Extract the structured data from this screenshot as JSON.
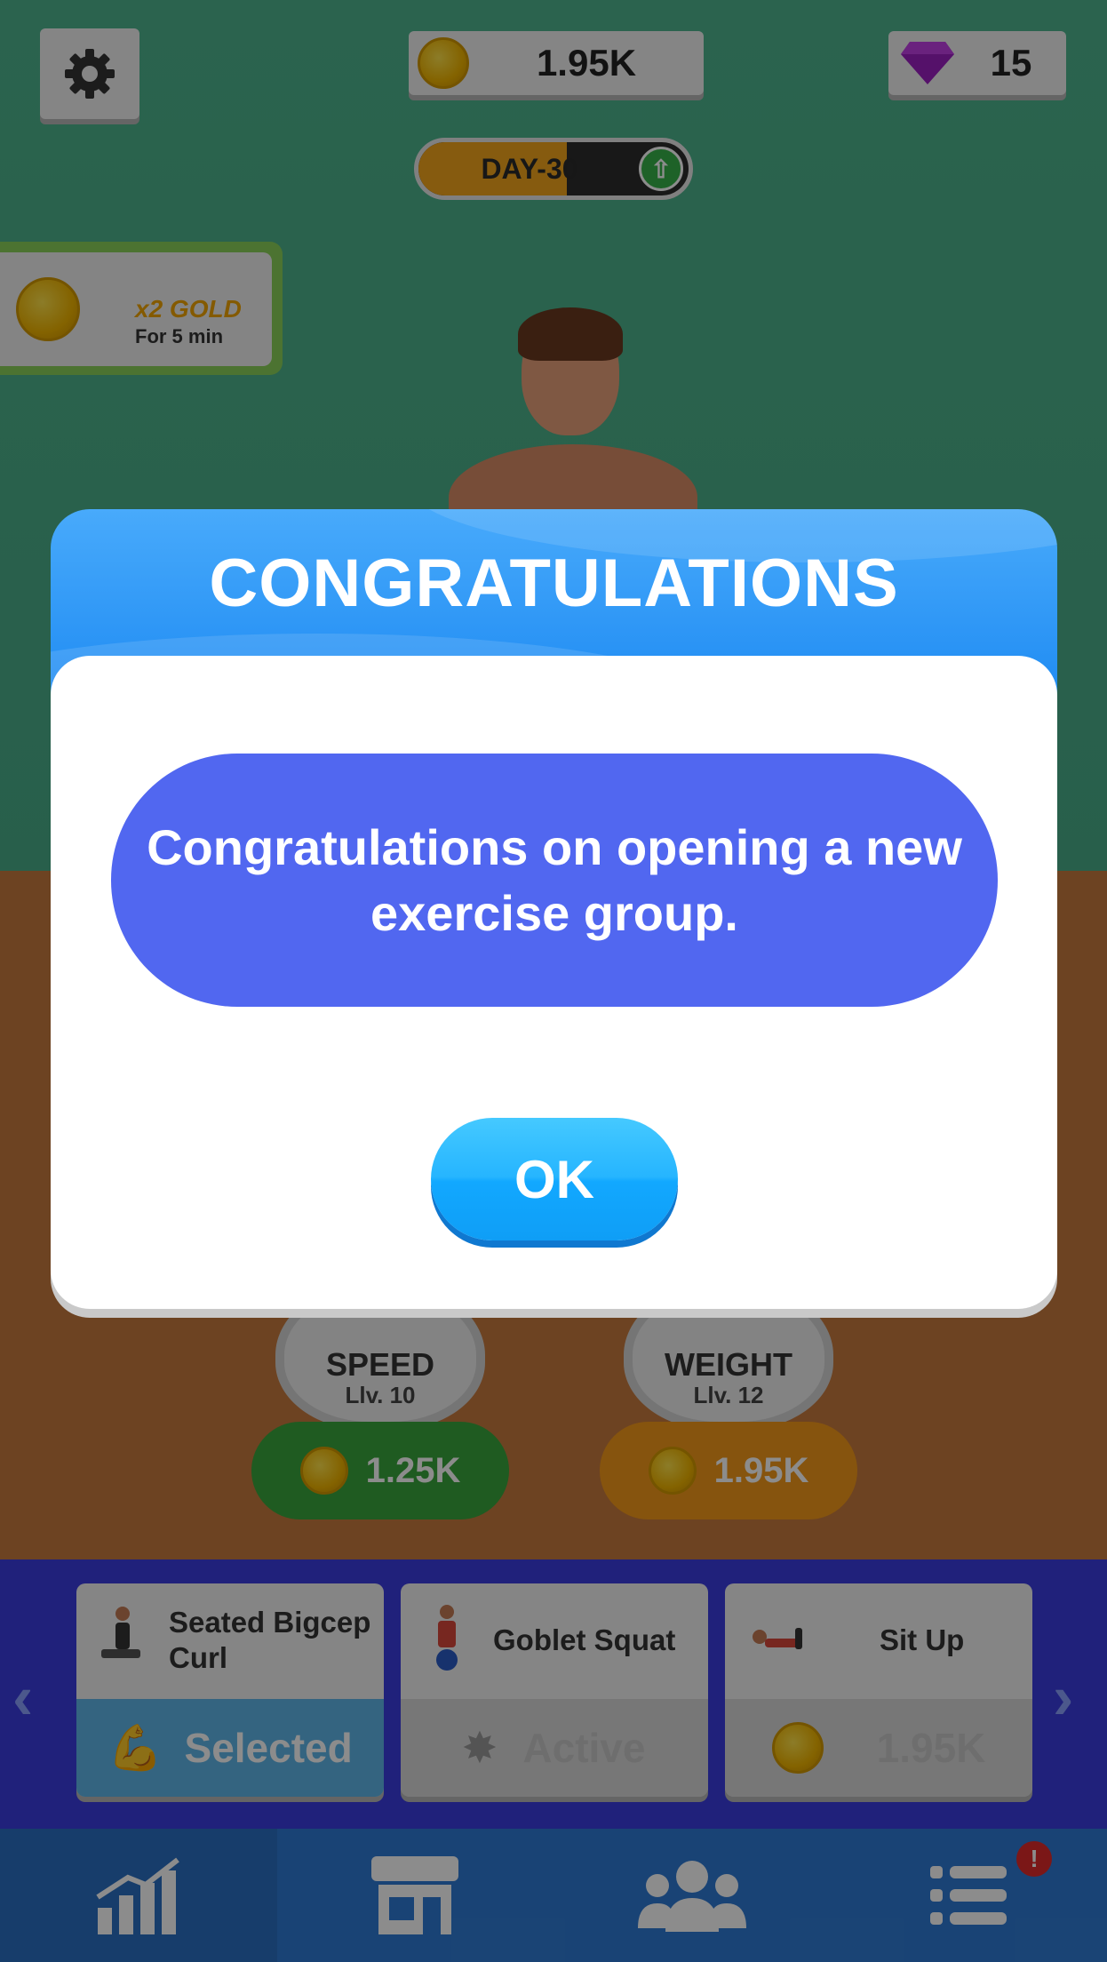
{
  "hud": {
    "gold": "1.95K",
    "gems": "15",
    "day_label": "DAY-30",
    "day_progress": 0.55
  },
  "boost": {
    "title": "x2 GOLD",
    "subtitle": "For 5 min"
  },
  "stats": [
    {
      "name": "SPEED",
      "level": "Llv. 10",
      "price": "1.25K",
      "color": "#3aa63c"
    },
    {
      "name": "WEIGHT",
      "level": "Llv. 12",
      "price": "1.95K",
      "color": "#f59a1b"
    }
  ],
  "exercises": [
    {
      "name": "Seated Bigcep Curl",
      "status": "Selected"
    },
    {
      "name": "Goblet Squat",
      "status": "Active"
    },
    {
      "name": "Sit Up",
      "status": "1.95K"
    }
  ],
  "nav": {
    "items": [
      "stats-icon",
      "shop-icon",
      "group-icon",
      "menu-icon"
    ],
    "badge": "!"
  },
  "dialog": {
    "title": "CONGRATULATIONS",
    "message": "Congratulations on opening a new exercise group.",
    "ok_label": "OK"
  },
  "colors": {
    "header_blue": "#1c89f2",
    "message_blue": "#5167f0",
    "ok_button": "#26b5ff"
  }
}
